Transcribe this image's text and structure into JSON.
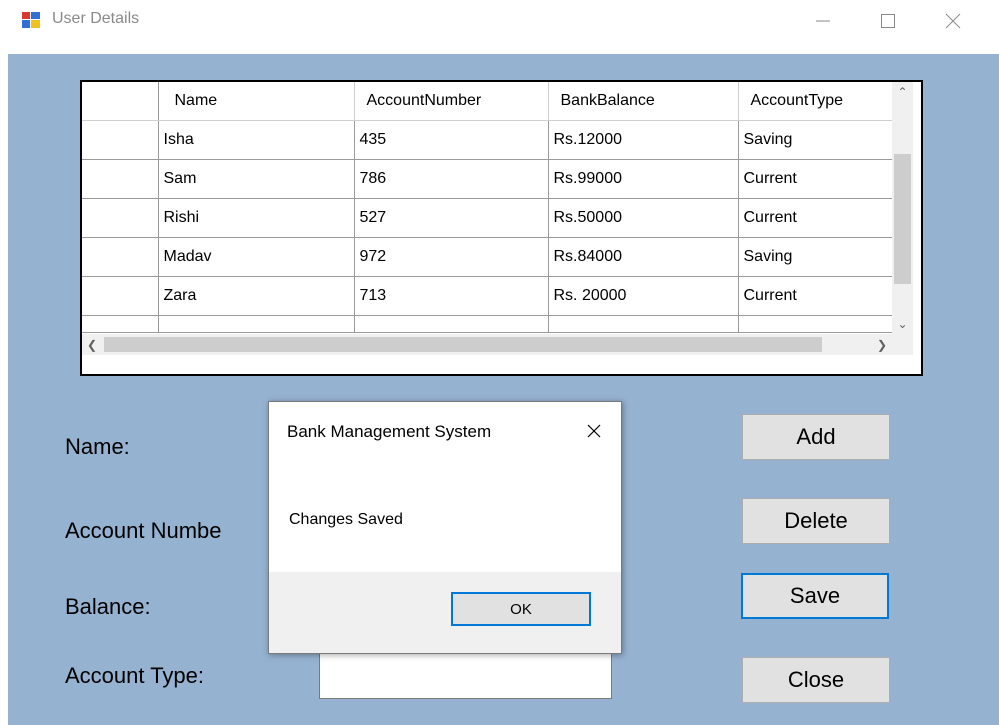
{
  "window": {
    "title": "User Details",
    "icon": "windows-form-icon",
    "controls": [
      "minimize-icon",
      "maximize-icon",
      "close-icon"
    ]
  },
  "grid": {
    "columns": [
      "Name",
      "AccountNumber",
      "BankBalance",
      "AccountType"
    ],
    "rows": [
      [
        "Isha",
        "435",
        "Rs.12000",
        "Saving"
      ],
      [
        "Sam",
        "786",
        "Rs.99000",
        "Current"
      ],
      [
        "Rishi",
        "527",
        "Rs.50000",
        "Current"
      ],
      [
        "Madav",
        "972",
        "Rs.84000",
        "Saving"
      ],
      [
        "Zara",
        "713",
        "Rs. 20000",
        "Current"
      ]
    ]
  },
  "form": {
    "name_label": "Name:",
    "account_number_label": "Account Numbe",
    "balance_label": "Balance:",
    "account_type_label": "Account Type:",
    "account_type_value": ""
  },
  "buttons": {
    "add": "Add",
    "delete": "Delete",
    "save": "Save",
    "close": "Close"
  },
  "message_box": {
    "title": "Bank Management System",
    "message": "Changes Saved",
    "ok": "OK"
  },
  "colors": {
    "form_background": "#95b2d1",
    "focus_border": "#0078d7"
  }
}
